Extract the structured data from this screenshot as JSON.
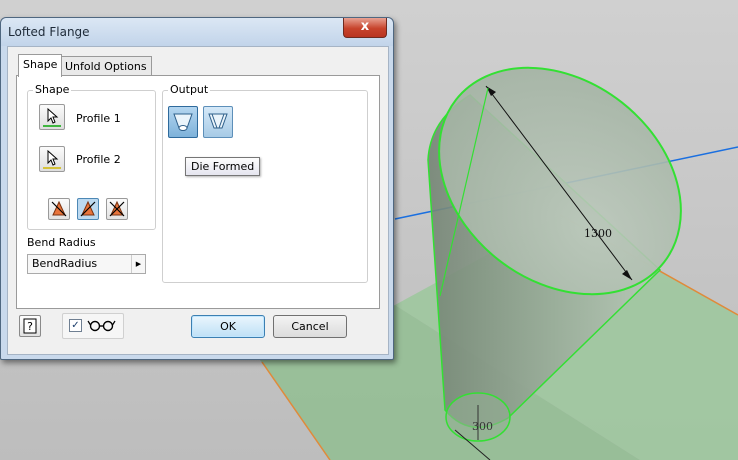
{
  "dialog": {
    "title": "Lofted Flange",
    "close_symbol": "x",
    "tabs": [
      {
        "label": "Shape",
        "active": true
      },
      {
        "label": "Unfold Options",
        "active": false
      }
    ],
    "shape_group": {
      "title": "Shape",
      "profiles": [
        {
          "label": "Profile 1",
          "icon": "cursor-select-icon"
        },
        {
          "label": "Profile 2",
          "icon": "cursor-select-icon"
        }
      ],
      "flip_buttons": [
        {
          "icon": "flip-direction-icon",
          "active": false
        },
        {
          "icon": "flip-direction-icon",
          "active": true
        },
        {
          "icon": "flip-direction-icon",
          "active": false
        }
      ]
    },
    "output_group": {
      "title": "Output",
      "buttons": [
        {
          "icon": "die-formed-icon",
          "active": true
        },
        {
          "icon": "press-brake-icon",
          "active": false
        }
      ],
      "tooltip": "Die Formed"
    },
    "bend_radius": {
      "label": "Bend Radius",
      "value": "BendRadius"
    },
    "help_icon": "help-icon",
    "preview": {
      "checked": true,
      "icon": "glasses-icon"
    },
    "ok_label": "OK",
    "cancel_label": "Cancel"
  },
  "viewport": {
    "dimension_large": "1300",
    "dimension_small": "300",
    "colors": {
      "background": "#c8c8c8",
      "edge_highlight": "#33e033",
      "axis_line": "#1a6fe0",
      "plane_fill": "#9cc89c",
      "plane_edge": "#e08a3a"
    }
  }
}
